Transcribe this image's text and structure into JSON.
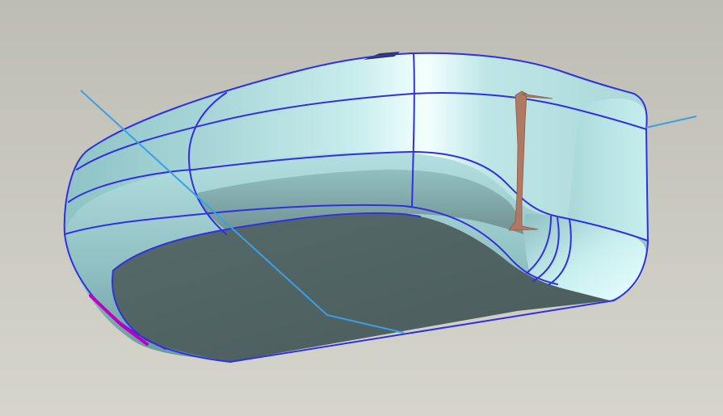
{
  "viewport": {
    "background_top": "#bebdb3",
    "background_bottom": "#d6d5cc"
  },
  "model": {
    "surface_color": "#b7e3e4",
    "surface_highlight": "#f4ffff",
    "surface_shadow": "#76a6a9",
    "bottom_face_color": "#4d5f5f",
    "edge_color": "#3030e0",
    "datum_axis_color": "#3aa0e6",
    "sketch_curve_color": "#b07a62",
    "highlighted_edge_color": "#c000c0"
  }
}
